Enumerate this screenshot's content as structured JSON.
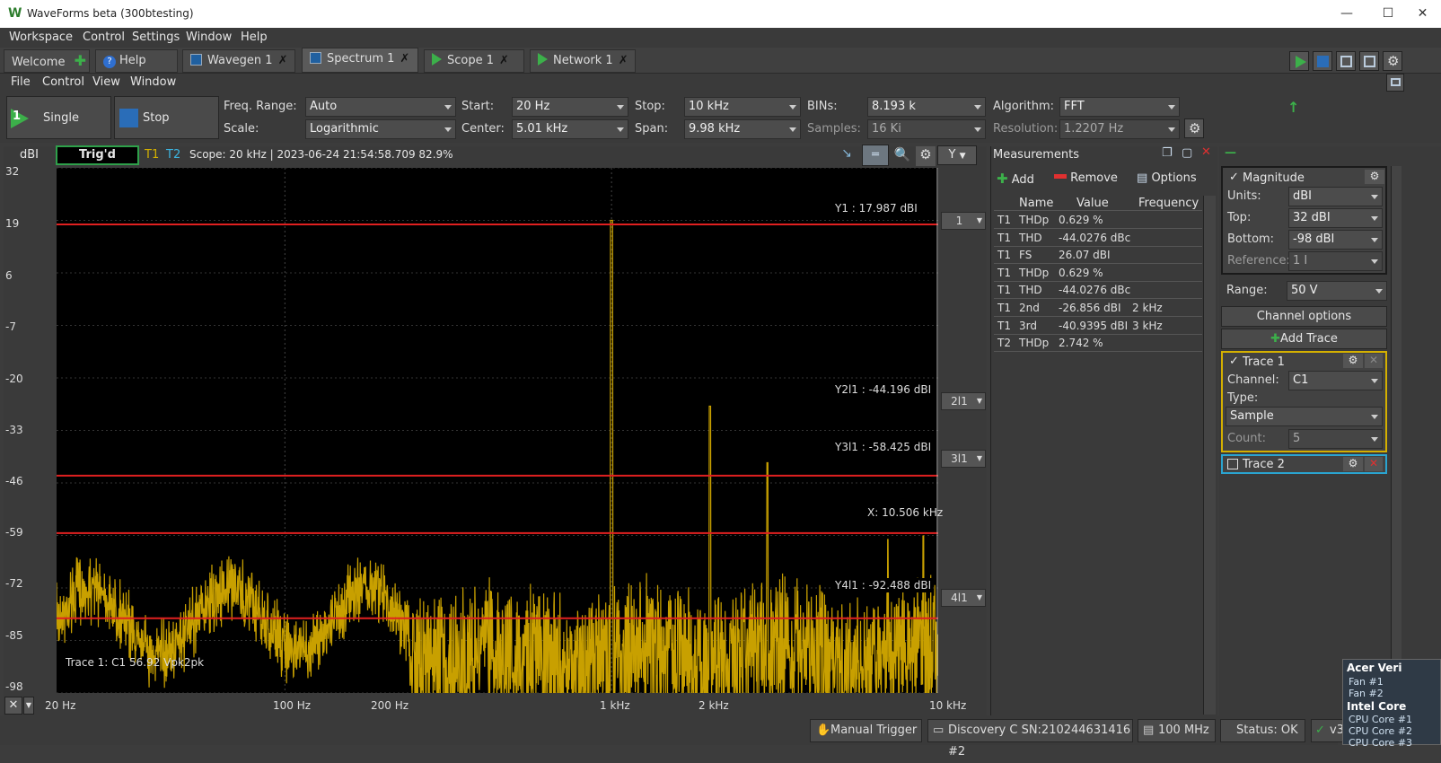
{
  "window": {
    "title": "WaveForms beta (300btesting)"
  },
  "menubar": [
    "Workspace",
    "Control",
    "Settings",
    "Window",
    "Help"
  ],
  "tabs": [
    {
      "label": "Welcome"
    },
    {
      "label": "Help"
    },
    {
      "label": "Wavegen 1"
    },
    {
      "label": "Spectrum 1"
    },
    {
      "label": "Scope 1"
    },
    {
      "label": "Network 1"
    }
  ],
  "submenu": [
    "File",
    "Control",
    "View",
    "Window"
  ],
  "toolbar": {
    "single_num": "1",
    "single_label": "Single",
    "stop_label": "Stop",
    "freq_range_label": "Freq. Range:",
    "freq_range_value": "Auto",
    "scale_label": "Scale:",
    "scale_value": "Logarithmic",
    "start_label": "Start:",
    "start_value": "20 Hz",
    "center_label": "Center:",
    "center_value": "5.01 kHz",
    "stop_label2": "Stop:",
    "stop_value": "10 kHz",
    "span_label": "Span:",
    "span_value": "9.98 kHz",
    "bins_label": "BINs:",
    "bins_value": "8.193 k",
    "samples_label": "Samples:",
    "samples_value": "16 Ki",
    "algorithm_label": "Algorithm:",
    "algorithm_value": "FFT",
    "resolution_label": "Resolution:",
    "resolution_value": "1.2207 Hz"
  },
  "plot": {
    "unit": "dBI",
    "trig": "Trig'd",
    "t1": "T1",
    "t2": "T2",
    "status": "Scope: 20 kHz | 2023-06-24 21:54:58.709 82.9%",
    "axis_btn": "Y",
    "y_ticks": [
      "32",
      "19",
      "6",
      "-7",
      "-20",
      "-33",
      "-46",
      "-59",
      "-72",
      "-85",
      "-98"
    ],
    "x_ticks": [
      "20 Hz",
      "100 Hz",
      "200 Hz",
      "1 kHz",
      "2 kHz",
      "10 kHz"
    ],
    "cursors": [
      {
        "label": "Y1 : 17.987 dBI",
        "btn": "1"
      },
      {
        "label": "Y2l1 : -44.196 dBI",
        "btn": "2l1"
      },
      {
        "label": "Y3l1 : -58.425 dBI",
        "btn": "3l1"
      },
      {
        "label": "Y4l1 : -92.488 dBI",
        "btn": "4l1"
      }
    ],
    "x_cursor": "X: 10.506 kHz",
    "trace_info": "Trace 1: C1 56.92 Vpk2pk",
    "trace_color": "#c8a000",
    "cursor_color": "#e02020"
  },
  "measurements": {
    "title": "Measurements",
    "add": "Add",
    "remove": "Remove",
    "options": "Options",
    "columns": [
      "Name",
      "Value",
      "Frequency"
    ],
    "rows": [
      {
        "t": "T1",
        "name": "THDp",
        "value": "0.629 %",
        "freq": ""
      },
      {
        "t": "T1",
        "name": "THD",
        "value": "-44.0276 dBc",
        "freq": ""
      },
      {
        "t": "T1",
        "name": "FS",
        "value": "26.07 dBI",
        "freq": ""
      },
      {
        "t": "T1",
        "name": "THDp",
        "value": "0.629 %",
        "freq": ""
      },
      {
        "t": "T1",
        "name": "THD",
        "value": "-44.0276 dBc",
        "freq": ""
      },
      {
        "t": "T1",
        "name": "2nd",
        "value": "-26.856 dBI",
        "freq": "2 kHz"
      },
      {
        "t": "T1",
        "name": "3rd",
        "value": "-40.9395 dBI",
        "freq": "3 kHz"
      },
      {
        "t": "T2",
        "name": "THDp",
        "value": "2.742 %",
        "freq": ""
      }
    ]
  },
  "settings": {
    "magnitude": "Magnitude",
    "units_label": "Units:",
    "units_value": "dBI",
    "top_label": "Top:",
    "top_value": "32 dBI",
    "bottom_label": "Bottom:",
    "bottom_value": "-98 dBI",
    "reference_label": "Reference:",
    "reference_value": "1 I",
    "range_label": "Range:",
    "range_value": "50 V",
    "channel_options": "Channel options",
    "add_trace": "Add Trace",
    "trace1": "Trace 1",
    "channel_label": "Channel:",
    "channel_value": "C1",
    "type_label": "Type:",
    "type_value": "Sample",
    "count_label": "Count:",
    "count_value": "5",
    "trace2": "Trace 2"
  },
  "statusbar": {
    "manual_trigger": "Manual Trigger",
    "device": "Discovery C SN:210244631416 #2",
    "clock": "100 MHz",
    "status": "Status: OK",
    "version": "v3"
  },
  "hwmonitor": {
    "title": "Acer Veri",
    "fans": [
      "Fan #1",
      "Fan #2"
    ],
    "cpu": "Intel Core",
    "cores": [
      "CPU Core #1",
      "CPU Core #2",
      "CPU Core #3"
    ]
  }
}
